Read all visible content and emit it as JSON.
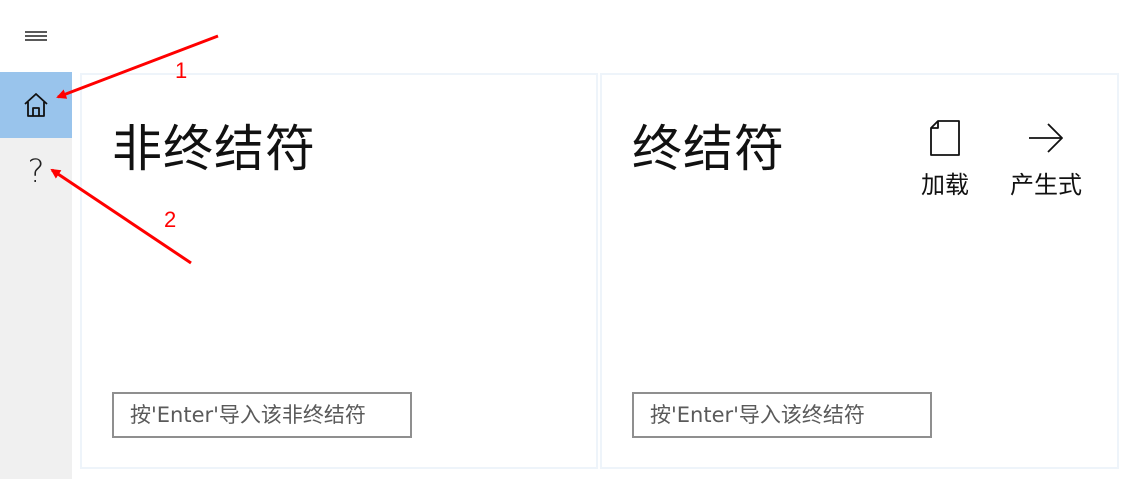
{
  "nav": {
    "menu_icon": "hamburger-menu-icon",
    "items": [
      {
        "icon": "home-icon",
        "selected": true
      },
      {
        "icon": "help-icon",
        "glyph": "?",
        "selected": false
      }
    ],
    "selected_color": "#99c4ec",
    "rail_color": "#f0f0f0"
  },
  "nonterminal_panel": {
    "title": "非终结符",
    "input_placeholder": "按'Enter'导入该非终结符"
  },
  "terminal_panel": {
    "title": "终结符",
    "input_placeholder": "按'Enter'导入该终结符",
    "actions": [
      {
        "icon": "document-icon",
        "label": "加载"
      },
      {
        "icon": "arrow-right-icon",
        "label": "产生式"
      }
    ]
  },
  "annotations": {
    "labels": [
      "1",
      "2"
    ],
    "color": "#ff0000"
  }
}
